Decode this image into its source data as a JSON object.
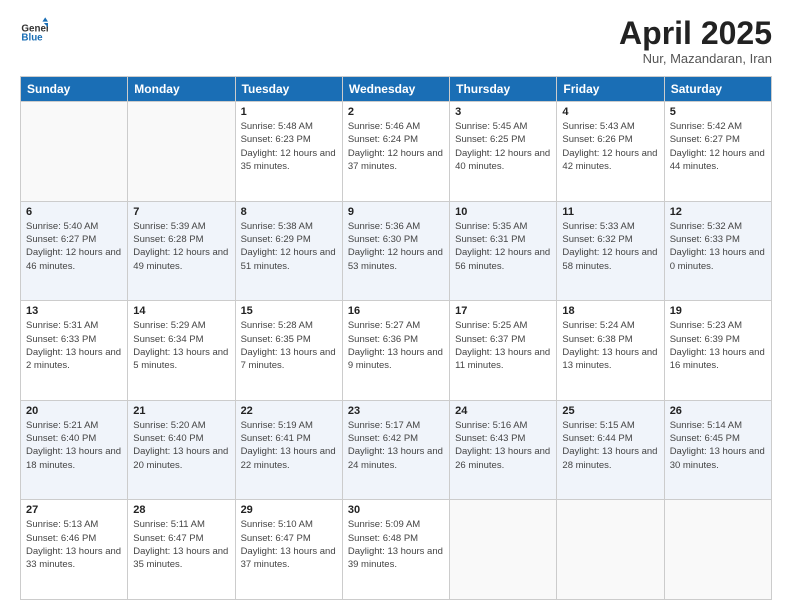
{
  "logo": {
    "general": "General",
    "blue": "Blue"
  },
  "title": "April 2025",
  "subtitle": "Nur, Mazandaran, Iran",
  "headers": [
    "Sunday",
    "Monday",
    "Tuesday",
    "Wednesday",
    "Thursday",
    "Friday",
    "Saturday"
  ],
  "weeks": [
    [
      {
        "day": "",
        "info": ""
      },
      {
        "day": "",
        "info": ""
      },
      {
        "day": "1",
        "info": "Sunrise: 5:48 AM\nSunset: 6:23 PM\nDaylight: 12 hours and 35 minutes."
      },
      {
        "day": "2",
        "info": "Sunrise: 5:46 AM\nSunset: 6:24 PM\nDaylight: 12 hours and 37 minutes."
      },
      {
        "day": "3",
        "info": "Sunrise: 5:45 AM\nSunset: 6:25 PM\nDaylight: 12 hours and 40 minutes."
      },
      {
        "day": "4",
        "info": "Sunrise: 5:43 AM\nSunset: 6:26 PM\nDaylight: 12 hours and 42 minutes."
      },
      {
        "day": "5",
        "info": "Sunrise: 5:42 AM\nSunset: 6:27 PM\nDaylight: 12 hours and 44 minutes."
      }
    ],
    [
      {
        "day": "6",
        "info": "Sunrise: 5:40 AM\nSunset: 6:27 PM\nDaylight: 12 hours and 46 minutes."
      },
      {
        "day": "7",
        "info": "Sunrise: 5:39 AM\nSunset: 6:28 PM\nDaylight: 12 hours and 49 minutes."
      },
      {
        "day": "8",
        "info": "Sunrise: 5:38 AM\nSunset: 6:29 PM\nDaylight: 12 hours and 51 minutes."
      },
      {
        "day": "9",
        "info": "Sunrise: 5:36 AM\nSunset: 6:30 PM\nDaylight: 12 hours and 53 minutes."
      },
      {
        "day": "10",
        "info": "Sunrise: 5:35 AM\nSunset: 6:31 PM\nDaylight: 12 hours and 56 minutes."
      },
      {
        "day": "11",
        "info": "Sunrise: 5:33 AM\nSunset: 6:32 PM\nDaylight: 12 hours and 58 minutes."
      },
      {
        "day": "12",
        "info": "Sunrise: 5:32 AM\nSunset: 6:33 PM\nDaylight: 13 hours and 0 minutes."
      }
    ],
    [
      {
        "day": "13",
        "info": "Sunrise: 5:31 AM\nSunset: 6:33 PM\nDaylight: 13 hours and 2 minutes."
      },
      {
        "day": "14",
        "info": "Sunrise: 5:29 AM\nSunset: 6:34 PM\nDaylight: 13 hours and 5 minutes."
      },
      {
        "day": "15",
        "info": "Sunrise: 5:28 AM\nSunset: 6:35 PM\nDaylight: 13 hours and 7 minutes."
      },
      {
        "day": "16",
        "info": "Sunrise: 5:27 AM\nSunset: 6:36 PM\nDaylight: 13 hours and 9 minutes."
      },
      {
        "day": "17",
        "info": "Sunrise: 5:25 AM\nSunset: 6:37 PM\nDaylight: 13 hours and 11 minutes."
      },
      {
        "day": "18",
        "info": "Sunrise: 5:24 AM\nSunset: 6:38 PM\nDaylight: 13 hours and 13 minutes."
      },
      {
        "day": "19",
        "info": "Sunrise: 5:23 AM\nSunset: 6:39 PM\nDaylight: 13 hours and 16 minutes."
      }
    ],
    [
      {
        "day": "20",
        "info": "Sunrise: 5:21 AM\nSunset: 6:40 PM\nDaylight: 13 hours and 18 minutes."
      },
      {
        "day": "21",
        "info": "Sunrise: 5:20 AM\nSunset: 6:40 PM\nDaylight: 13 hours and 20 minutes."
      },
      {
        "day": "22",
        "info": "Sunrise: 5:19 AM\nSunset: 6:41 PM\nDaylight: 13 hours and 22 minutes."
      },
      {
        "day": "23",
        "info": "Sunrise: 5:17 AM\nSunset: 6:42 PM\nDaylight: 13 hours and 24 minutes."
      },
      {
        "day": "24",
        "info": "Sunrise: 5:16 AM\nSunset: 6:43 PM\nDaylight: 13 hours and 26 minutes."
      },
      {
        "day": "25",
        "info": "Sunrise: 5:15 AM\nSunset: 6:44 PM\nDaylight: 13 hours and 28 minutes."
      },
      {
        "day": "26",
        "info": "Sunrise: 5:14 AM\nSunset: 6:45 PM\nDaylight: 13 hours and 30 minutes."
      }
    ],
    [
      {
        "day": "27",
        "info": "Sunrise: 5:13 AM\nSunset: 6:46 PM\nDaylight: 13 hours and 33 minutes."
      },
      {
        "day": "28",
        "info": "Sunrise: 5:11 AM\nSunset: 6:47 PM\nDaylight: 13 hours and 35 minutes."
      },
      {
        "day": "29",
        "info": "Sunrise: 5:10 AM\nSunset: 6:47 PM\nDaylight: 13 hours and 37 minutes."
      },
      {
        "day": "30",
        "info": "Sunrise: 5:09 AM\nSunset: 6:48 PM\nDaylight: 13 hours and 39 minutes."
      },
      {
        "day": "",
        "info": ""
      },
      {
        "day": "",
        "info": ""
      },
      {
        "day": "",
        "info": ""
      }
    ]
  ]
}
